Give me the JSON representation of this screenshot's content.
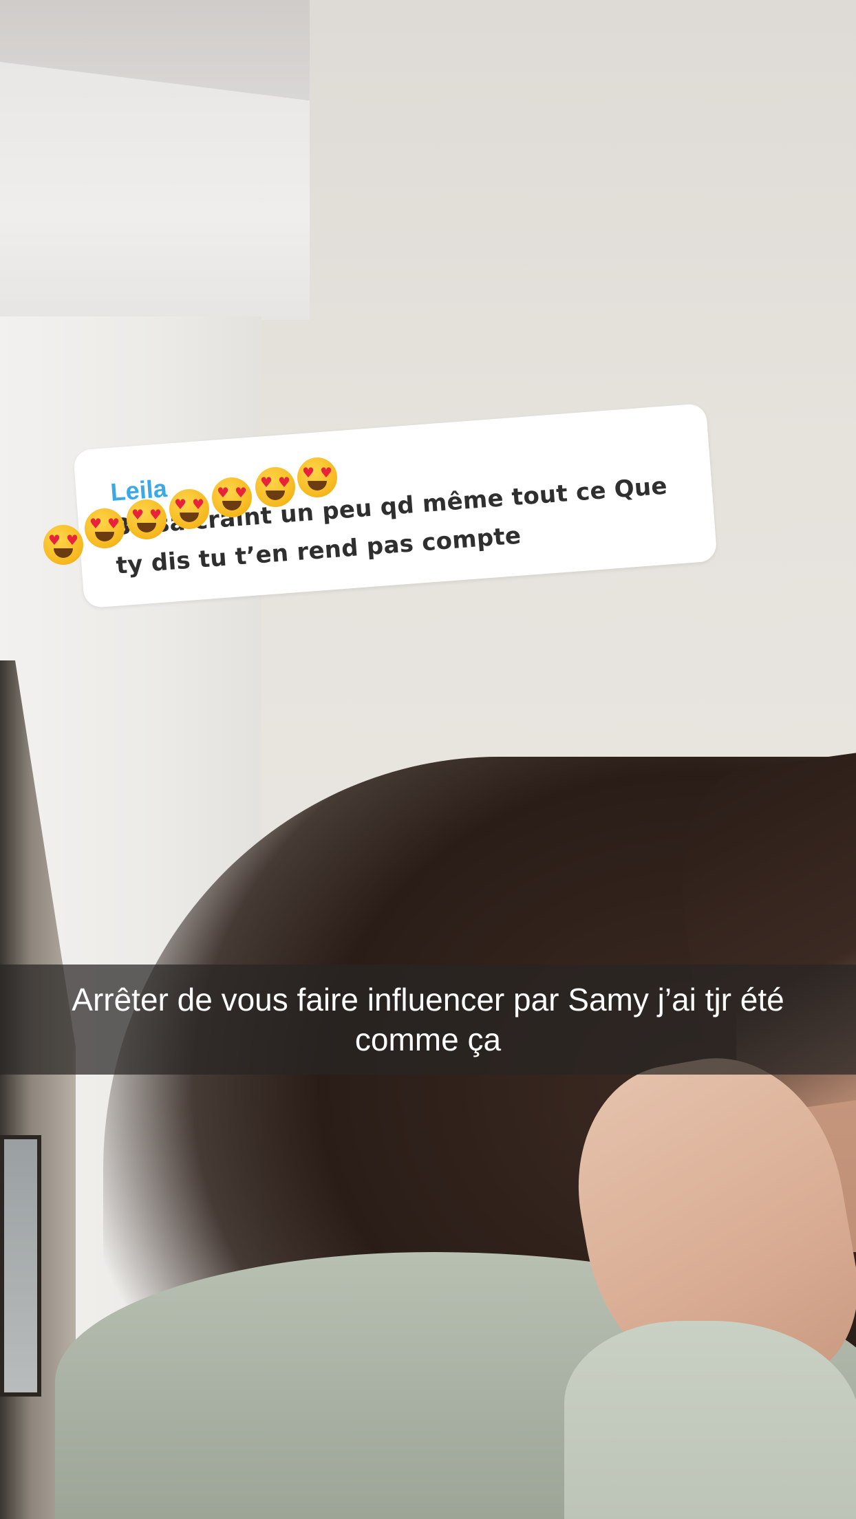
{
  "question_sticker": {
    "sender_name": "Leila",
    "question_text": "Ba sa craint un peu qd même tout ce Que ty dis tu t’en rend pas compte",
    "emojis": [
      "heart-eyes-emoji",
      "heart-eyes-emoji",
      "heart-eyes-emoji",
      "heart-eyes-emoji",
      "heart-eyes-emoji",
      "heart-eyes-emoji",
      "heart-eyes-emoji"
    ]
  },
  "caption": {
    "text": "Arrêter de vous faire influencer par Samy j’ai tjr été comme ça"
  },
  "colors": {
    "sender_name": "#3aa9e8",
    "question_text": "#2f2f2f",
    "caption_bar": "#282624",
    "caption_text": "#ffffff"
  }
}
